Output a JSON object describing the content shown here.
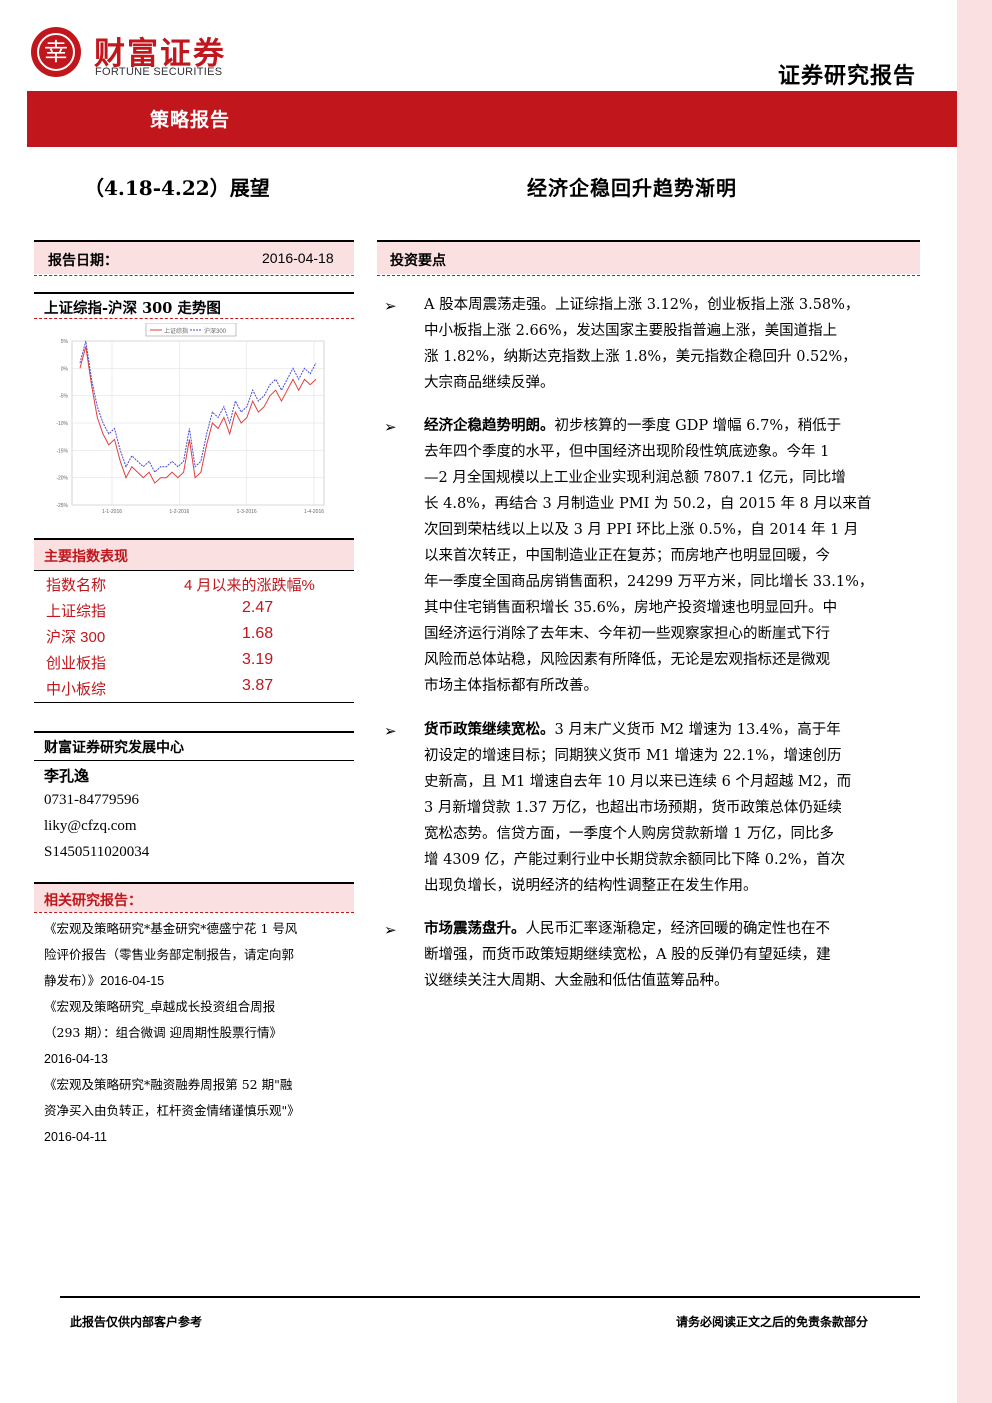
{
  "header": {
    "brand_cn": "财富证券",
    "brand_en": "FORTUNE SECURITIES",
    "report_type": "证券研究报告",
    "bar_title": "策略报告",
    "week": "（4.18-4.22）展望",
    "title": "经济企稳回升趋势渐明"
  },
  "left": {
    "date_label": "报告日期：",
    "date_value": "2016-04-18",
    "chart_title": "上证综指-沪深 300 走势图",
    "index_table": {
      "title": "主要指数表现",
      "headers": [
        "指数名称",
        "4 月以来的涨跌幅%"
      ],
      "rows": [
        {
          "name": "上证综指",
          "value": "2.47"
        },
        {
          "name": "沪深 300",
          "value": "1.68"
        },
        {
          "name": "创业板指",
          "value": "3.19"
        },
        {
          "name": "中小板综",
          "value": "3.87"
        }
      ]
    },
    "analyst": {
      "center": "财富证券研究发展中心",
      "name": "李孔逸",
      "phone": "0731-84779596",
      "email": "liky@cfzq.com",
      "cert": "S1450511020034"
    },
    "related": {
      "title": "相关研究报告：",
      "lines": [
        "《宏观及策略研究*基金研究*德盛宁花 1 号风",
        "险评价报告（零售业务部定制报告，请定向郭",
        "静发布）》2016-04-15",
        "《宏观及策略研究_卓越成长投资组合周报",
        "（293 期）：组合微调 迎周期性股票行情》",
        "2016-04-13",
        "《宏观及策略研究*融资融券周报第 52 期\"融",
        "资净买入由负转正，杠杆资金情绪谨慎乐观\"》",
        "2016-04-11"
      ]
    }
  },
  "right": {
    "section_title": "投资要点",
    "bullets": [
      {
        "lead": "",
        "lines": [
          "A 股本周震荡走强。上证综指上涨 3.12%，创业板指上涨 3.58%，",
          "中小板指上涨 2.66%，发达国家主要股指普遍上涨，美国道指上",
          "涨 1.82%，纳斯达克指数上涨 1.8%，美元指数企稳回升 0.52%，",
          "大宗商品继续反弹。"
        ]
      },
      {
        "lead": "经济企稳趋势明朗。",
        "lines": [
          "初步核算的一季度 GDP 增幅 6.7%，稍低于",
          "去年四个季度的水平，但中国经济出现阶段性筑底迹象。今年 1",
          "—2 月全国规模以上工业企业实现利润总额 7807.1 亿元，同比增",
          "长 4.8%，再结合 3 月制造业 PMI 为 50.2，自 2015 年 8 月以来首",
          "次回到荣枯线以上以及 3 月 PPI 环比上涨 0.5%，自 2014 年 1 月",
          "以来首次转正，中国制造业正在复苏；而房地产也明显回暖，今",
          "年一季度全国商品房销售面积，24299 万平方米，同比增长 33.1%，",
          "其中住宅销售面积增长 35.6%，房地产投资增速也明显回升。中",
          "国经济运行消除了去年末、今年初一些观察家担心的断崖式下行",
          "风险而总体站稳，风险因素有所降低，无论是宏观指标还是微观",
          "市场主体指标都有所改善。"
        ]
      },
      {
        "lead": "货币政策继续宽松。",
        "lines": [
          "3 月末广义货币 M2 增速为 13.4%，高于年",
          "初设定的增速目标；同期狭义货币 M1 增速为 22.1%，增速创历",
          "史新高，且 M1 增速自去年 10 月以来已连续 6 个月超越 M2，而",
          "3 月新增贷款 1.37 万亿，也超出市场预期，货币政策总体仍延续",
          "宽松态势。信贷方面，一季度个人购房贷款新增 1 万亿，同比多",
          "增 4309 亿，产能过剩行业中长期贷款余额同比下降 0.2%，首次",
          "出现负增长，说明经济的结构性调整正在发生作用。"
        ]
      },
      {
        "lead": "市场震荡盘升。",
        "lines": [
          "人民币汇率逐渐稳定，经济回暖的确定性也在不",
          "断增强，而货币政策短期继续宽松，A 股的反弹仍有望延续，建",
          "议继续关注大周期、大金融和低估值蓝筹品种。"
        ]
      }
    ]
  },
  "footer": {
    "left": "此报告仅供内部客户参考",
    "right": "请务必阅读正文之后的免责条款部分"
  },
  "chart_data": {
    "type": "line",
    "series": [
      {
        "name": "上证综指",
        "color": "#e0403f",
        "values": [
          0,
          4,
          -3,
          -9,
          -12,
          -14,
          -13,
          -17,
          -20,
          -18,
          -19,
          -20,
          -19,
          -21,
          -20,
          -20,
          -19,
          -20,
          -19,
          -13,
          -20,
          -19,
          -14,
          -10,
          -11,
          -9,
          -12,
          -8,
          -10,
          -9,
          -6,
          -8,
          -7,
          -5,
          -4,
          -6,
          -4,
          -2,
          -4,
          -2,
          -3,
          -2
        ]
      },
      {
        "name": "沪深300",
        "color": "#4a4ad6",
        "values": [
          1,
          5,
          -2,
          -7,
          -10,
          -12,
          -11,
          -15,
          -18,
          -16,
          -17,
          -18,
          -17,
          -19,
          -18,
          -18,
          -17,
          -18,
          -17,
          -11,
          -18,
          -17,
          -12,
          -8,
          -9,
          -7,
          -10,
          -6,
          -8,
          -7,
          -4,
          -6,
          -5,
          -3,
          -2,
          -4,
          -2,
          0,
          -2,
          0,
          -1,
          1
        ]
      }
    ],
    "y_ticks": [
      "5%",
      "0%",
      "-5%",
      "-10%",
      "-15%",
      "-20%",
      "-25%"
    ],
    "ylim": [
      -25,
      5
    ],
    "x_ticks": [
      "1-1-2016",
      "1-2-2016",
      "1-3-2016",
      "1-4-2016"
    ],
    "grid": true,
    "legend": "top"
  }
}
